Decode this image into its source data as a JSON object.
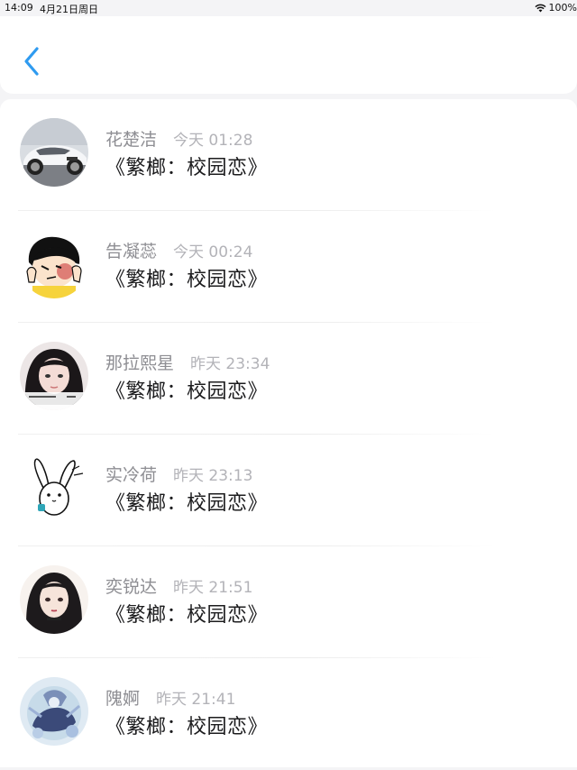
{
  "status_bar": {
    "time": "14:09",
    "date": "4月21日周日",
    "battery": "100%"
  },
  "colors": {
    "accent": "#2f9bf0",
    "name": "#8e8e93",
    "timestamp": "#b3b3b8",
    "message": "#1c1c1e"
  },
  "nav": {
    "back_icon": "chevron-left-icon"
  },
  "conversations": [
    {
      "name": "花楚洁",
      "time": "今天 01:28",
      "message": "《繁榔：校园恋》"
    },
    {
      "name": "告凝蕊",
      "time": "今天 00:24",
      "message": "《繁榔：校园恋》"
    },
    {
      "name": "那拉熙星",
      "time": "昨天 23:34",
      "message": "《繁榔：校园恋》"
    },
    {
      "name": "实冷荷",
      "time": "昨天 23:13",
      "message": "《繁榔：校园恋》"
    },
    {
      "name": "奕锐达",
      "time": "昨天 21:51",
      "message": "《繁榔：校园恋》"
    },
    {
      "name": "隗婀",
      "time": "昨天 21:41",
      "message": "《繁榔：校园恋》"
    }
  ]
}
